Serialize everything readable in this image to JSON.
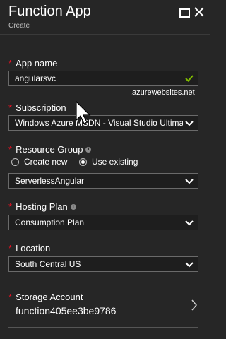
{
  "header": {
    "title": "Function App",
    "subtitle": "Create"
  },
  "app_name": {
    "label": "App name",
    "value": "angularsvc",
    "suffix": ".azurewebsites.net"
  },
  "subscription": {
    "label": "Subscription",
    "value": "Windows Azure MSDN - Visual Studio Ultimate"
  },
  "resource_group": {
    "label": "Resource Group",
    "option_new": "Create new",
    "option_existing": "Use existing",
    "selected": "Use existing",
    "value": "ServerlessAngular"
  },
  "hosting_plan": {
    "label": "Hosting Plan",
    "value": "Consumption Plan"
  },
  "location": {
    "label": "Location",
    "value": "South Central US"
  },
  "storage": {
    "label": "Storage Account",
    "value": "function405ee3be9786"
  },
  "icons": {
    "info": "info-icon",
    "check": "check-icon",
    "chevron": "chevron-down-icon",
    "nav": "chevron-right-icon"
  },
  "colors": {
    "required": "#e81123",
    "check": "#7fba00",
    "background": "#262626"
  }
}
